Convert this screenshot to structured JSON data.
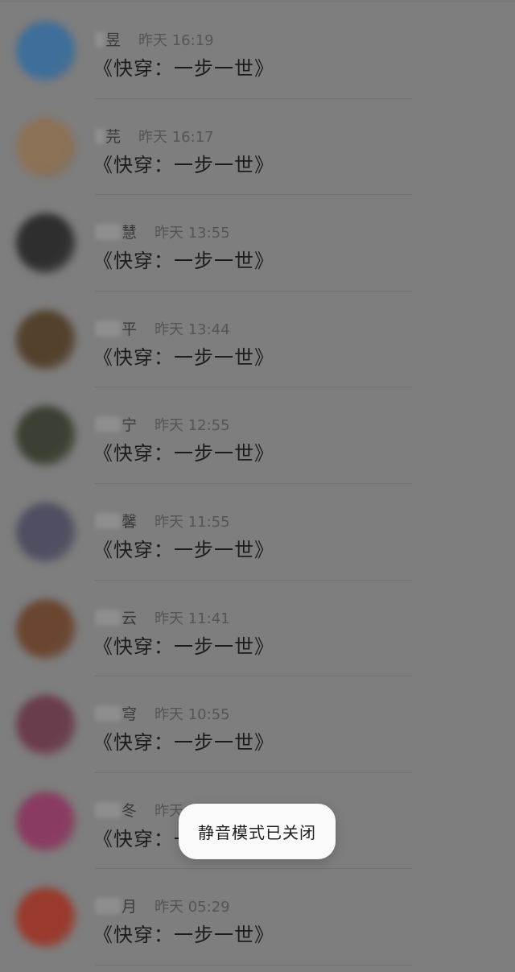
{
  "conversations": [
    {
      "name_suffix": "昱",
      "time": "昨天 16:19",
      "message": "《快穿：一步一世》",
      "avatar_color": "#3d6f9a"
    },
    {
      "name_suffix": "芫",
      "time": "昨天 16:17",
      "message": "《快穿：一步一世》",
      "avatar_color": "#8c7256"
    },
    {
      "name_suffix": "慧",
      "time": "昨天 13:55",
      "message": "《快穿：一步一世》",
      "avatar_color": "#2e2e2e"
    },
    {
      "name_suffix": "平",
      "time": "昨天 13:44",
      "message": "《快穿：一步一世》",
      "avatar_color": "#54412c"
    },
    {
      "name_suffix": "宁",
      "time": "昨天 12:55",
      "message": "《快穿：一步一世》",
      "avatar_color": "#3b4032"
    },
    {
      "name_suffix": "馨",
      "time": "昨天 11:55",
      "message": "《快穿：一步一世》",
      "avatar_color": "#4f4f62"
    },
    {
      "name_suffix": "云",
      "time": "昨天 11:41",
      "message": "《快穿：一步一世》",
      "avatar_color": "#6a4630"
    },
    {
      "name_suffix": "穹",
      "time": "昨天 10:55",
      "message": "《快穿：一步一世》",
      "avatar_color": "#6a3d4c"
    },
    {
      "name_suffix": "冬",
      "time": "昨天 09:03",
      "message": "《快穿：一步一世》",
      "avatar_color": "#8a3c60"
    },
    {
      "name_suffix": "月",
      "time": "昨天 05:29",
      "message": "《快穿：一步一世》",
      "avatar_color": "#9a3a2c"
    }
  ],
  "toast": {
    "text": "静音模式已关闭"
  }
}
